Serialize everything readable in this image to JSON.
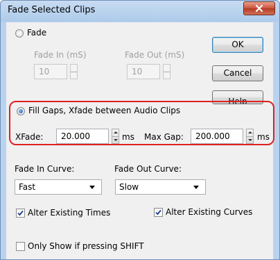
{
  "window": {
    "title": "Fade Selected Clips",
    "close_icon": "close-x-icon"
  },
  "fade": {
    "label": "Fade",
    "fade_in_label": "Fade In (mS)",
    "fade_in_value": "10",
    "fade_out_label": "Fade Out (mS)",
    "fade_out_value": "10"
  },
  "buttons": {
    "ok": "OK",
    "cancel": "Cancel",
    "help": "Help"
  },
  "fill_gaps": {
    "label": "Fill Gaps, Xfade between Audio Clips",
    "xfade_label": "XFade:",
    "xfade_value": "20.000",
    "xfade_unit": "ms",
    "max_gap_label": "Max Gap:",
    "max_gap_value": "200.000",
    "max_gap_unit": "ms",
    "highlight_color": "#e02020"
  },
  "curves": {
    "fade_in_label": "Fade In Curve:",
    "fade_in_value": "Fast",
    "fade_out_label": "Fade Out Curve:",
    "fade_out_value": "Slow"
  },
  "options": {
    "alter_times": "Alter Existing Times",
    "alter_curves": "Alter Existing Curves",
    "only_shift": "Only Show if pressing SHIFT"
  }
}
